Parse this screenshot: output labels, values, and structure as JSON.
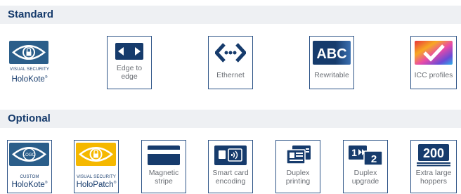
{
  "sections": {
    "standard": "Standard",
    "optional": "Optional"
  },
  "standard_cards": {
    "holokote": {
      "line1": "VISUAL SECURITY",
      "brand": "HoloKote",
      "mark": "®"
    },
    "edge": {
      "label": "Edge to\nedge"
    },
    "ethernet": {
      "label": "Ethernet"
    },
    "rewritable": {
      "label": "Rewritable",
      "icon_text": "ABC"
    },
    "icc": {
      "label": "ICC profiles"
    }
  },
  "optional_cards": {
    "custom_holokote": {
      "logo": "LOGO",
      "line1": "CUSTOM",
      "brand": "HoloKote",
      "mark": "®"
    },
    "holopatch": {
      "line1": "VISUAL SECURITY",
      "brand": "HoloPatch",
      "mark": "®"
    },
    "magnetic": {
      "label": "Magnetic\nstripe"
    },
    "smartcard": {
      "label": "Smart card\nencoding"
    },
    "duplex_print": {
      "label": "Duplex\nprinting"
    },
    "duplex_upgrade": {
      "label": "Duplex\nupgrade",
      "icon_a": "1",
      "icon_b": "2"
    },
    "hoppers": {
      "label": "Extra large\nhoppers",
      "icon_text": "200"
    }
  },
  "colors": {
    "brand_navy": "#163b6c",
    "card_border": "#2f5588",
    "section_bg": "#eef0f3",
    "holokote_blue": "#2b5e8a",
    "holopatch_yellow": "#f5b800"
  },
  "icons": {
    "holokote": "eye-padlock-icon",
    "edge": "edge-arrows-icon",
    "ethernet": "ethernet-arrows-icon",
    "rewritable": "rewritable-abc-icon",
    "icc": "color-checkmark-icon",
    "custom_holokote": "eye-logo-icon",
    "holopatch": "eye-padlock-icon",
    "magnetic": "magnetic-card-icon",
    "smartcard": "smart-card-icon",
    "duplex_print": "duplex-cards-icon",
    "duplex_upgrade": "duplex-upgrade-icon",
    "hoppers": "hopper-200-icon"
  }
}
